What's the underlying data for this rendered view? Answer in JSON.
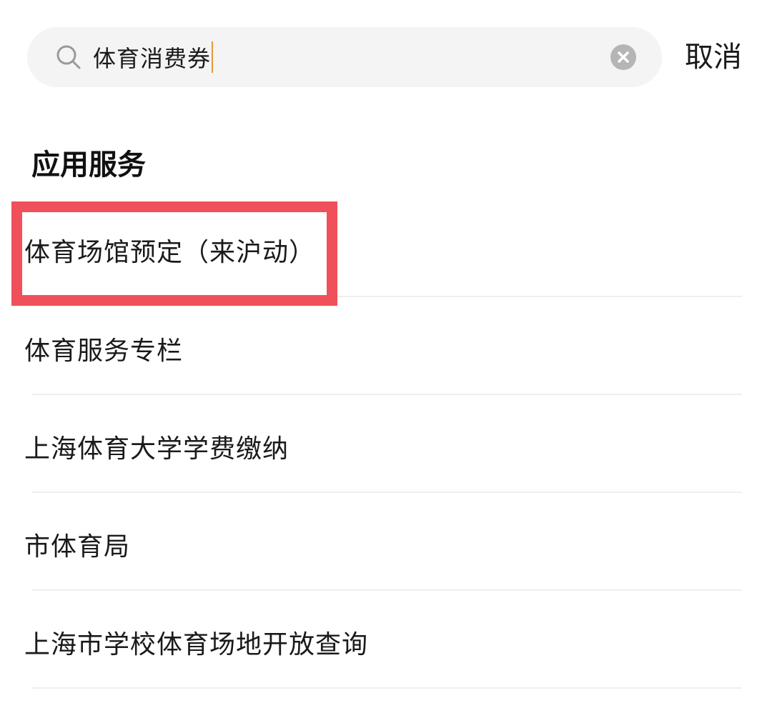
{
  "search": {
    "query": "体育消费券",
    "cancel_label": "取消"
  },
  "section": {
    "title": "应用服务"
  },
  "results": [
    {
      "label": "体育场馆预定（来沪动）"
    },
    {
      "label": "体育服务专栏"
    },
    {
      "label": "上海体育大学学费缴纳"
    },
    {
      "label": "市体育局"
    },
    {
      "label": "上海市学校体育场地开放查询"
    }
  ],
  "icons": {
    "search": "search-icon",
    "clear": "clear-icon"
  },
  "colors": {
    "highlight": "#f0505a",
    "search_bg": "#f4f4f4",
    "caret": "#e09a3a",
    "clear_icon_bg": "#b5b5b5"
  }
}
